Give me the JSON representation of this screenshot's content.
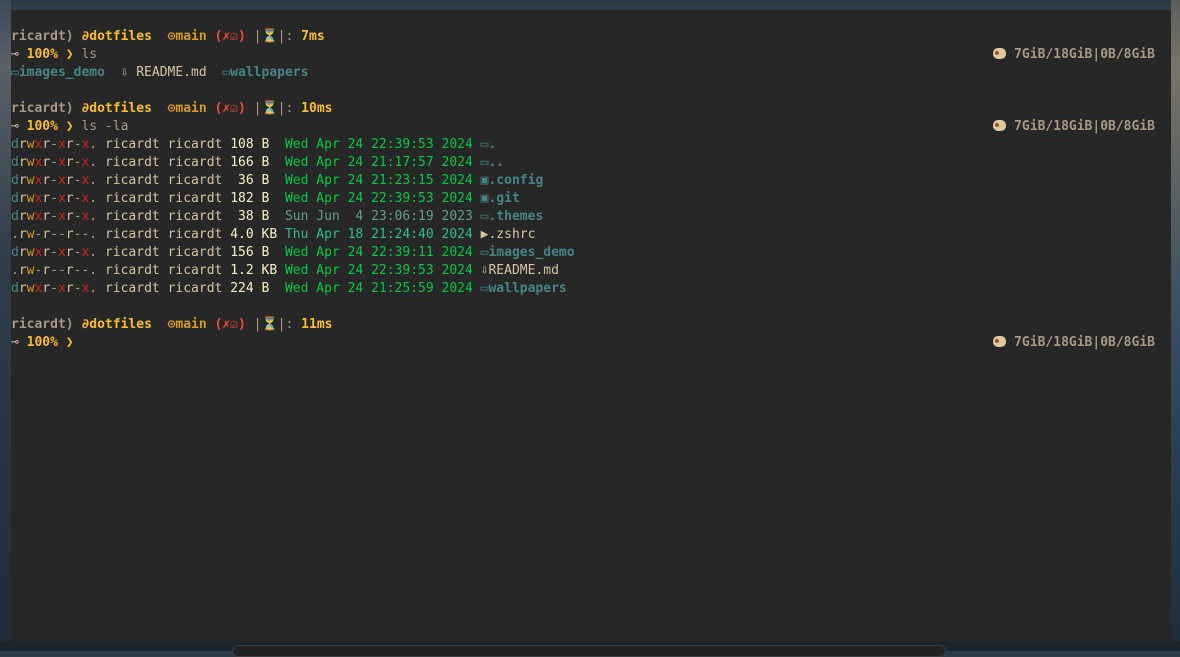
{
  "prompt": {
    "user": "ricardt",
    "dir": "dotfiles",
    "branch": "main",
    "battery": "100%",
    "arrow": "❯",
    "right_status": "7GiB/18GiB|0B/8GiB"
  },
  "durations": [
    "7ms",
    "10ms",
    "11ms"
  ],
  "commands": [
    "ls",
    "ls -la",
    ""
  ],
  "ls_output": [
    {
      "name": "images_demo",
      "type": "folder"
    },
    {
      "name": "README.md",
      "type": "file"
    },
    {
      "name": "wallpapers",
      "type": "folder"
    }
  ],
  "listing": [
    {
      "perm": "drwxr-xr-x.",
      "user": "ricardt",
      "group": "ricardt",
      "size": "108 B ",
      "date": "Wed Apr 24 22:39:53 2024",
      "icon": "folder-open-icon",
      "name": ".",
      "type": "folder"
    },
    {
      "perm": "drwxr-xr-x.",
      "user": "ricardt",
      "group": "ricardt",
      "size": "166 B ",
      "date": "Wed Apr 24 21:17:57 2024",
      "icon": "folder-open-icon",
      "name": "..",
      "type": "folder"
    },
    {
      "perm": "drwxr-xr-x.",
      "user": "ricardt",
      "group": "ricardt",
      "size": " 36 B ",
      "date": "Wed Apr 24 21:23:15 2024",
      "icon": "config-folder-icon",
      "name": ".config",
      "type": "folder"
    },
    {
      "perm": "drwxr-xr-x.",
      "user": "ricardt",
      "group": "ricardt",
      "size": "182 B ",
      "date": "Wed Apr 24 22:39:53 2024",
      "icon": "git-folder-icon",
      "name": ".git",
      "type": "folder"
    },
    {
      "perm": "drwxr-xr-x.",
      "user": "ricardt",
      "group": "ricardt",
      "size": " 38 B ",
      "date": "Sun Jun  4 23:06:19 2023",
      "icon": "folder-open-icon",
      "name": ".themes",
      "type": "folder"
    },
    {
      "perm": ".rw-r--r--.",
      "user": "ricardt",
      "group": "ricardt",
      "size": "4.0 KB",
      "date": "Thu Apr 18 21:24:40 2024",
      "icon": "terminal-icon",
      "name": ".zshrc",
      "type": "file"
    },
    {
      "perm": "drwxr-xr-x.",
      "user": "ricardt",
      "group": "ricardt",
      "size": "156 B ",
      "date": "Wed Apr 24 22:39:11 2024",
      "icon": "folder-open-icon",
      "name": "images_demo",
      "type": "folder"
    },
    {
      "perm": ".rw-r--r--.",
      "user": "ricardt",
      "group": "ricardt",
      "size": "1.2 KB",
      "date": "Wed Apr 24 22:39:53 2024",
      "icon": "download-icon",
      "name": "README.md",
      "type": "file"
    },
    {
      "perm": "drwxr-xr-x.",
      "user": "ricardt",
      "group": "ricardt",
      "size": "224 B ",
      "date": "Wed Apr 24 21:25:59 2024",
      "icon": "folder-open-icon",
      "name": "wallpapers",
      "type": "folder"
    }
  ]
}
